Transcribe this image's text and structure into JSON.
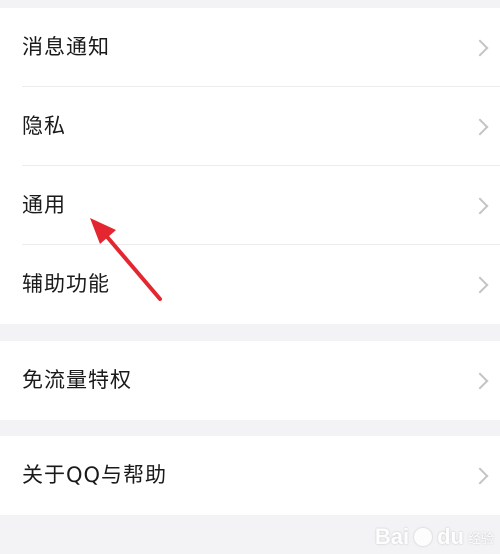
{
  "settings": {
    "group1": [
      {
        "label": "消息通知"
      },
      {
        "label": "隐私"
      },
      {
        "label": "通用"
      },
      {
        "label": "辅助功能"
      }
    ],
    "group2": [
      {
        "label": "免流量特权"
      }
    ],
    "group3": [
      {
        "label": "关于QQ与帮助"
      }
    ]
  },
  "annotation": {
    "color": "#e3262f",
    "icon": "red-arrow-pointing-to-general"
  },
  "watermark": {
    "brand": "Bai",
    "brand2": "du",
    "sub": "经验"
  },
  "colors": {
    "background": "#f3f3f6",
    "card": "#ffffff",
    "text": "#1a1a1a",
    "chevron": "#c4c4c8"
  }
}
